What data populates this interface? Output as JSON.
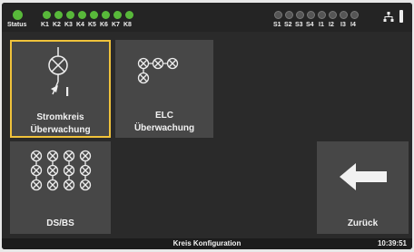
{
  "statusbar": {
    "status_label": "Status",
    "relays": [
      "K1",
      "K2",
      "K3",
      "K4",
      "K5",
      "K6",
      "K7",
      "K8"
    ],
    "inputs": [
      "S1",
      "S2",
      "S3",
      "S4",
      "I1",
      "I2",
      "I3",
      "I4"
    ],
    "colors": {
      "on": "#58b83a",
      "off": "#555555"
    }
  },
  "tiles": {
    "stromkreis": {
      "line1": "Stromkreis",
      "line2": "Überwachung",
      "icon": "circuit-measure-icon",
      "selected": true
    },
    "elc": {
      "line1": "ELC",
      "line2": "Überwachung",
      "icon": "lamp-group-icon"
    },
    "dsbs": {
      "line1": "DS/BS",
      "icon": "lamp-matrix-icon"
    },
    "zurueck": {
      "line1": "Zurück",
      "icon": "arrow-left-icon"
    }
  },
  "bottombar": {
    "title": "Kreis Konfiguration",
    "time": "10:39:51"
  },
  "accent": "#f0c23b"
}
